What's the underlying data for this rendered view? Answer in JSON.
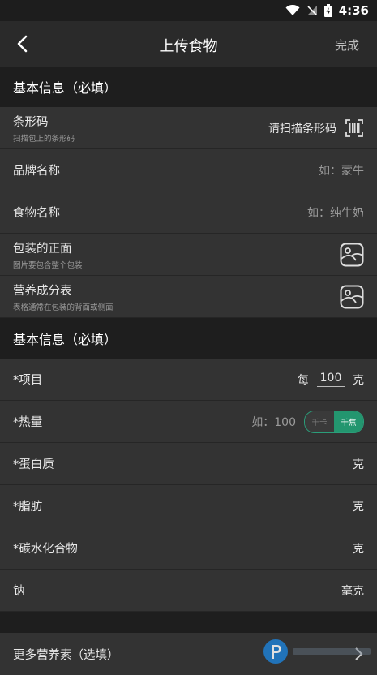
{
  "status": {
    "time": "4:36"
  },
  "nav": {
    "title": "上传食物",
    "done": "完成"
  },
  "section1": {
    "title": "基本信息（必填）",
    "rows": [
      {
        "label": "条形码",
        "sub": "扫描包上的条形码",
        "value": "请扫描条形码"
      },
      {
        "label": "品牌名称",
        "placeholder": "如：蒙牛"
      },
      {
        "label": "食物名称",
        "placeholder": "如：纯牛奶"
      },
      {
        "label": "包装的正面",
        "sub": "图片要包含整个包装"
      },
      {
        "label": "营养成分表",
        "sub": "表格通常在包装的背面或侧面"
      }
    ]
  },
  "section2": {
    "title": "基本信息（必填）",
    "item": {
      "label": "*项目",
      "prefix": "每",
      "amount": "100",
      "unit": "克"
    },
    "energy": {
      "label": "*热量",
      "placeholder": "如：100",
      "toggle_off": "千卡",
      "toggle_on": "千焦"
    },
    "protein": {
      "label": "*蛋白质",
      "unit": "克"
    },
    "fat": {
      "label": "*脂肪",
      "unit": "克"
    },
    "carbs": {
      "label": "*碳水化合物",
      "unit": "克"
    },
    "sodium": {
      "label": "钠",
      "unit": "毫克"
    }
  },
  "more": {
    "label": "更多营养素（选填）"
  }
}
